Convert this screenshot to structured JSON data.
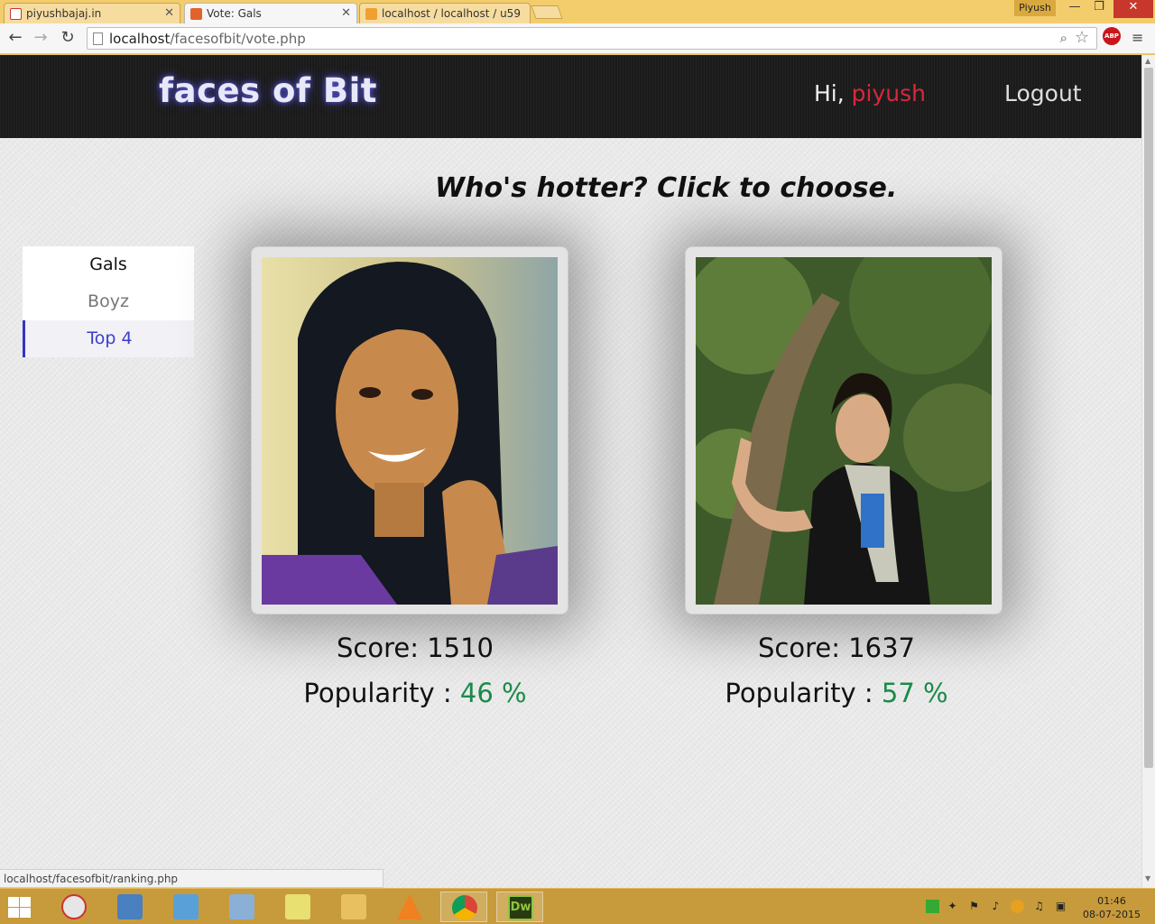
{
  "browser": {
    "tabs": [
      {
        "title": "piyushbajaj.in",
        "active": false
      },
      {
        "title": "Vote: Gals",
        "active": true
      },
      {
        "title": "localhost / localhost / u59",
        "active": false
      }
    ],
    "profile_name": "Piyush",
    "url_host": "localhost",
    "url_path": "/facesofbit/vote.php",
    "window_controls": {
      "minimize": "—",
      "restore": "❐",
      "close": "✕"
    }
  },
  "site": {
    "logo": "faces of Bit",
    "greeting_prefix": "Hi,",
    "username": "piyush",
    "logout_label": "Logout",
    "tagline": "Who's hotter? Click to choose.",
    "menu": [
      {
        "label": "Gals",
        "state": "current"
      },
      {
        "label": "Boyz",
        "state": "normal"
      },
      {
        "label": "Top  4",
        "state": "active"
      }
    ],
    "contestants": [
      {
        "score_label": "Score:",
        "score": "1510",
        "popularity_label": "Popularity :",
        "popularity": "46 %",
        "photo": "woman-smiling-portrait"
      },
      {
        "score_label": "Score:",
        "score": "1637",
        "popularity_label": "Popularity :",
        "popularity": "57 %",
        "photo": "woman-by-tree-outdoor"
      }
    ]
  },
  "status_url": "localhost/facesofbit/ranking.php",
  "taskbar": {
    "time": "01:46",
    "date": "08-07-2015",
    "open_app": "Dw"
  },
  "colors": {
    "username": "#d8283a",
    "popularity": "#1b8a4a",
    "active_menu": "#3d3dcc",
    "taskbar": "#c79b3c"
  }
}
